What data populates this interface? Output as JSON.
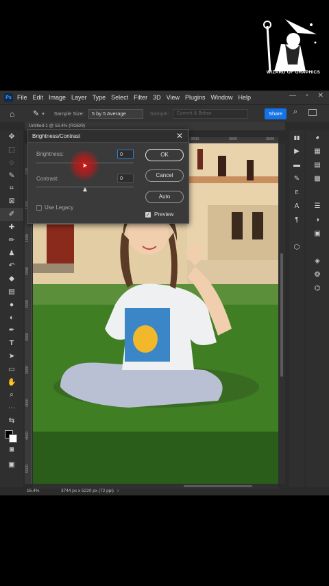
{
  "branding": {
    "logo_text": "WIZARD OF GRAPHICS"
  },
  "app": {
    "icon_label": "Ps",
    "menu": [
      "File",
      "Edit",
      "Image",
      "Layer",
      "Type",
      "Select",
      "Filter",
      "3D",
      "View",
      "Plugins",
      "Window",
      "Help"
    ]
  },
  "options_bar": {
    "sample_size_label": "Sample Size:",
    "sample_size_value": "5 by 5 Average",
    "sample_label": "Sample:",
    "sample_value": "Current & Below",
    "share_label": "Share"
  },
  "document": {
    "tab_title": "Untitled-1 @ 16.4% (RGB/8)",
    "zoom": "16.4%",
    "info": "3744 px x 5220 px (72 ppi)",
    "ruler_top": [
      "2500",
      "3000",
      "3500"
    ],
    "ruler_left": [
      "500",
      "1000",
      "1500",
      "2000",
      "2500",
      "3000",
      "3500",
      "4000",
      "4500",
      "5000"
    ]
  },
  "dialog": {
    "title": "Brightness/Contrast",
    "brightness_label": "Brightness:",
    "brightness_value": "0",
    "contrast_label": "Contrast:",
    "contrast_value": "0",
    "use_legacy_label": "Use Legacy",
    "use_legacy_checked": false,
    "ok_label": "OK",
    "cancel_label": "Cancel",
    "auto_label": "Auto",
    "preview_label": "Preview",
    "preview_checked": true
  },
  "colors": {
    "accent": "#1473e6",
    "foreground": "#000000",
    "background": "#ffffff",
    "cursor_highlight": "#d41414"
  }
}
